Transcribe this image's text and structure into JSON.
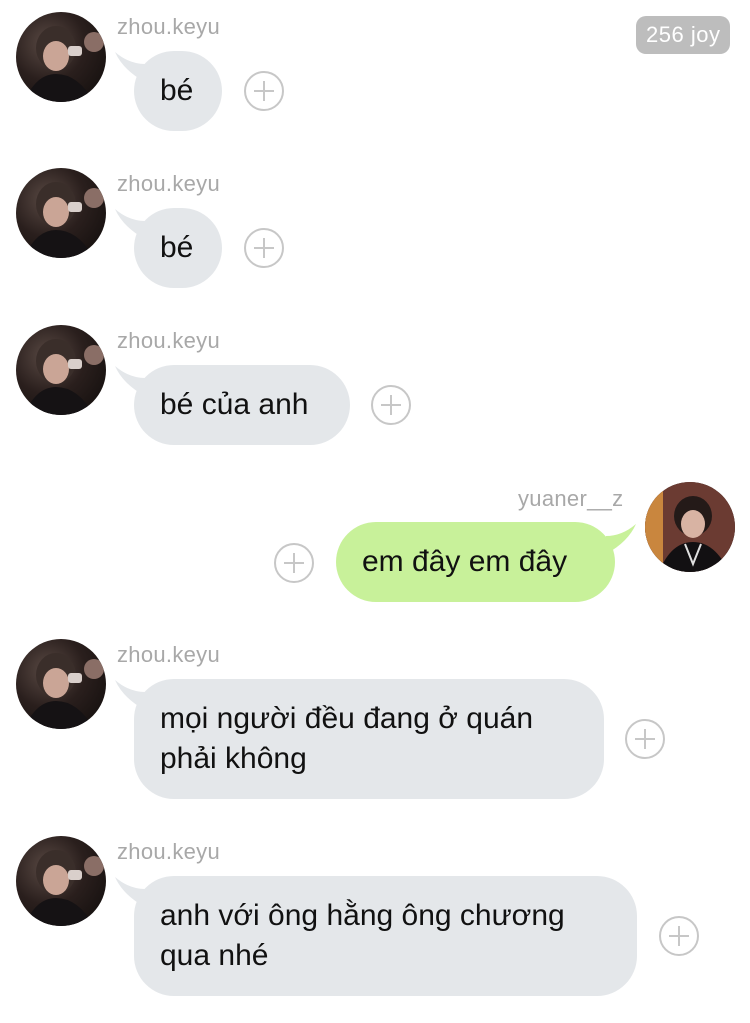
{
  "badge": {
    "text": "256 joy"
  },
  "messages": [
    {
      "sender": "zhou.keyu",
      "text": "bé"
    },
    {
      "sender": "zhou.keyu",
      "text": "bé"
    },
    {
      "sender": "zhou.keyu",
      "text": "bé của anh"
    },
    {
      "sender": "yuaner__z",
      "text": "em đây em đây"
    },
    {
      "sender": "zhou.keyu",
      "lines": [
        "mọi người đều đang ở quán",
        "phải không"
      ]
    },
    {
      "sender": "zhou.keyu",
      "lines": [
        "anh với ông hằng ông chương",
        "qua nhé"
      ]
    }
  ],
  "colors": {
    "incoming": "#e4e7ea",
    "outgoing": "#c8f19a",
    "meta": "#a8a8a8"
  }
}
